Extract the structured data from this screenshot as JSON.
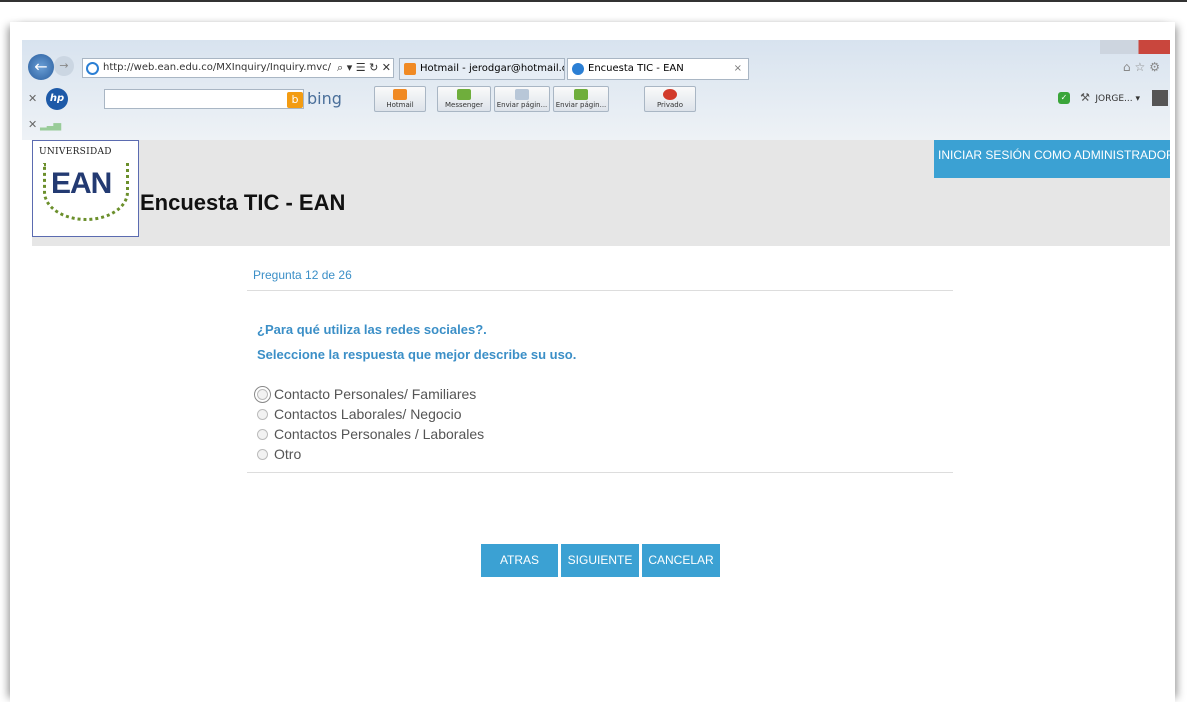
{
  "browser": {
    "address": "http://web.ean.edu.co/MXInquiry/Inquiry.mvc/",
    "address_controls": "⌕ ▾ ☰ ↻ ✕",
    "tabs": [
      {
        "label": "Hotmail - jerodgar@hotmail.c...",
        "color": "#f08a24"
      },
      {
        "label": "Encuesta TIC - EAN",
        "color": "#2b7fd4"
      }
    ],
    "tab_close": "×",
    "search_brand": "bing",
    "toolbar_buttons": [
      "Hotmail",
      "Messenger",
      "Enviar págin...",
      "Enviar págin...",
      "Privado"
    ],
    "user_label": "JORGE... ▾",
    "hp_label": "hp"
  },
  "header": {
    "logo_university": "UNIVERSIDAD",
    "logo_ean": "EAN",
    "site_title": "Encuesta TIC - EAN",
    "admin_button": "INICIAR SESIÓN COMO ADMINISTRADOR"
  },
  "survey": {
    "counter": "Pregunta 12 de 26",
    "question": "¿Para qué utiliza las redes sociales?.",
    "instruction": "Seleccione la respuesta que mejor describe su uso.",
    "options": [
      "Contacto Personales/ Familiares",
      "Contactos Laborales/ Negocio",
      "Contactos Personales / Laborales",
      "Otro"
    ]
  },
  "actions": {
    "back": "ATRAS",
    "next": "SIGUIENTE",
    "cancel": "CANCELAR"
  },
  "colors": {
    "accent": "#3ba1d3",
    "question_text": "#3b8fc7"
  }
}
